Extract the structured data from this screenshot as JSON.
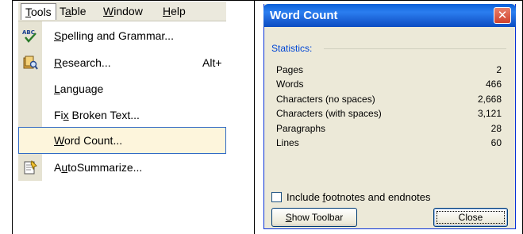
{
  "tools_menu": {
    "menubar": [
      {
        "pre": "",
        "accel": "T",
        "post": "ools"
      },
      {
        "pre": "T",
        "accel": "a",
        "post": "ble"
      },
      {
        "pre": "",
        "accel": "W",
        "post": "indow"
      },
      {
        "pre": "",
        "accel": "H",
        "post": "elp"
      }
    ],
    "items": [
      {
        "pre": "",
        "accel": "S",
        "post": "pelling and Grammar...",
        "shortcut": "",
        "icon": "spelling-icon"
      },
      {
        "pre": "",
        "accel": "R",
        "post": "esearch...",
        "shortcut": "Alt+",
        "icon": "research-icon"
      },
      {
        "pre": "",
        "accel": "L",
        "post": "anguage",
        "shortcut": "",
        "icon": ""
      },
      {
        "pre": "Fi",
        "accel": "x",
        "post": " Broken Text...",
        "shortcut": "",
        "icon": ""
      },
      {
        "pre": "",
        "accel": "W",
        "post": "ord Count...",
        "shortcut": "",
        "icon": ""
      },
      {
        "pre": "A",
        "accel": "u",
        "post": "toSummarize...",
        "shortcut": "",
        "icon": "autosummarize-icon"
      }
    ]
  },
  "word_count_dialog": {
    "title": "Word Count",
    "close_glyph": "✕",
    "group_label": "Statistics:",
    "stats": [
      {
        "label": "Pages",
        "value": "2"
      },
      {
        "label": "Words",
        "value": "466"
      },
      {
        "label": "Characters (no spaces)",
        "value": "2,668"
      },
      {
        "label": "Characters (with spaces)",
        "value": "3,121"
      },
      {
        "label": "Paragraphs",
        "value": "28"
      },
      {
        "label": "Lines",
        "value": "60"
      }
    ],
    "checkbox": {
      "pre": "Include ",
      "accel": "f",
      "post": "ootnotes and endnotes",
      "checked": false
    },
    "show_toolbar": {
      "pre": "",
      "accel": "S",
      "post": "how Toolbar"
    },
    "close_button": "Close"
  },
  "colors": {
    "titlebar_blue": "#0a5fd8",
    "highlight_border": "#316ac5",
    "highlight_fill": "#fdf5dc",
    "dialog_face": "#ece9d8"
  }
}
